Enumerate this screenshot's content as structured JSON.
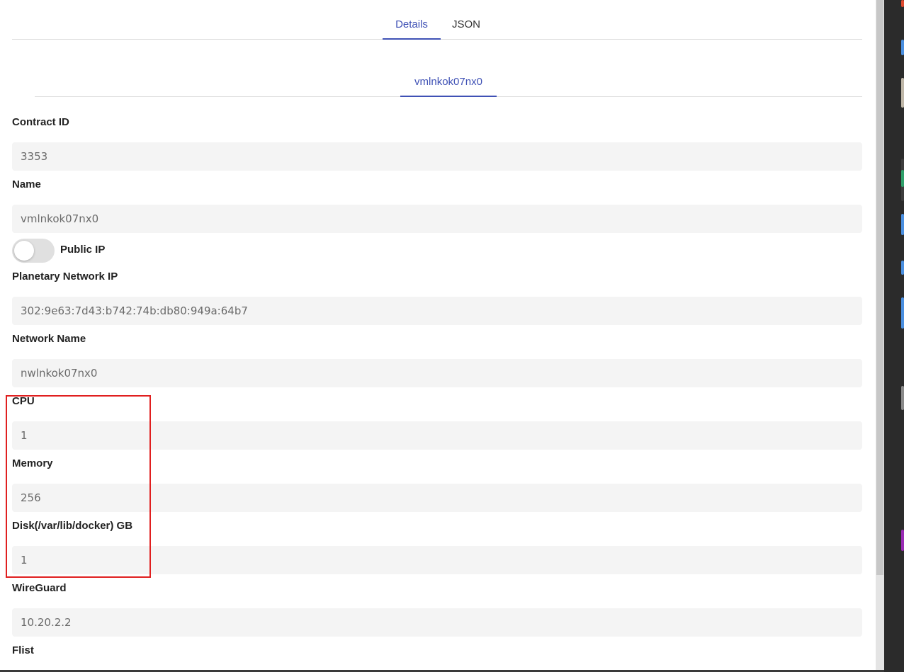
{
  "tabs": {
    "details": "Details",
    "json": "JSON"
  },
  "vm_tab": "vmlnkok07nx0",
  "fields": {
    "contract_id": {
      "label": "Contract ID",
      "value": "3353"
    },
    "name": {
      "label": "Name",
      "value": "vmlnkok07nx0"
    },
    "public_ip": {
      "label": "Public IP",
      "enabled": false
    },
    "planetary_ip": {
      "label": "Planetary Network IP",
      "value": "302:9e63:7d43:b742:74b:db80:949a:64b7"
    },
    "network_name": {
      "label": "Network Name",
      "value": "nwlnkok07nx0"
    },
    "cpu": {
      "label": "CPU",
      "value": "1"
    },
    "memory": {
      "label": "Memory",
      "value": "256"
    },
    "disk": {
      "label": "Disk(/var/lib/docker) GB",
      "value": "1"
    },
    "wireguard": {
      "label": "WireGuard",
      "value": "10.20.2.2"
    },
    "flist": {
      "label": "Flist"
    }
  },
  "colors": {
    "accent": "#3f51b5",
    "highlight": "#e01f1f",
    "field_bg": "#f4f4f4"
  }
}
